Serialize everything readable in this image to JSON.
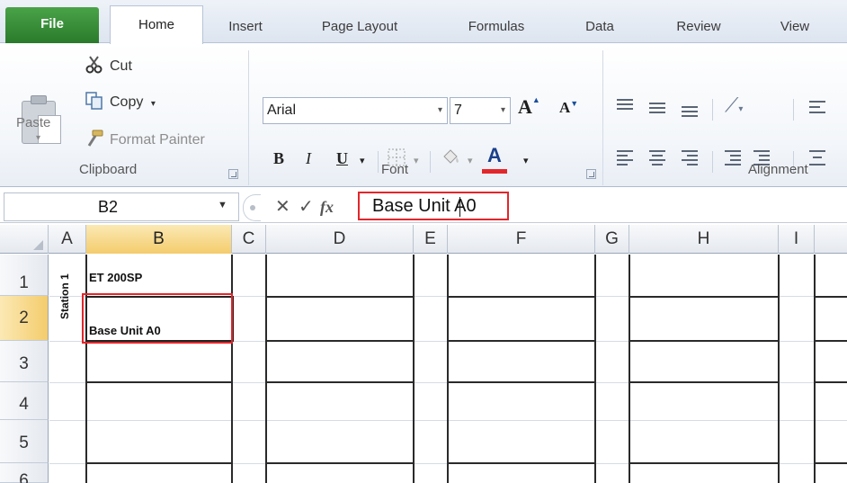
{
  "ribbon_tabs": [
    {
      "label": "File"
    },
    {
      "label": "Home"
    },
    {
      "label": "Insert"
    },
    {
      "label": "Page Layout"
    },
    {
      "label": "Formulas"
    },
    {
      "label": "Data"
    },
    {
      "label": "Review"
    },
    {
      "label": "View"
    }
  ],
  "clipboard": {
    "paste_label": "Paste",
    "cut_label": "Cut",
    "copy_label": "Copy",
    "format_painter_label": "Format Painter",
    "group_label": "Clipboard"
  },
  "font": {
    "font_name": "Arial",
    "font_size": "7",
    "bold_label": "B",
    "italic_label": "I",
    "underline_label": "U",
    "font_color_label": "A",
    "grow_label": "A",
    "shrink_label": "A",
    "group_label": "Font",
    "font_color": "#e3262b"
  },
  "alignment": {
    "group_label": "Alignment"
  },
  "formula_bar": {
    "cell_reference": "B2",
    "formula_value": "Base Unit A0",
    "fx_label": "fx"
  },
  "columns": [
    "A",
    "B",
    "C",
    "D",
    "E",
    "F",
    "G",
    "H",
    "I"
  ],
  "rows": [
    "1",
    "2",
    "3",
    "4",
    "5",
    "6"
  ],
  "cells": {
    "A1": "Station 1",
    "B1": "ET 200SP",
    "B2": "Base Unit A0"
  },
  "selected_cell": "B2",
  "highlight_color": "#e3262b"
}
